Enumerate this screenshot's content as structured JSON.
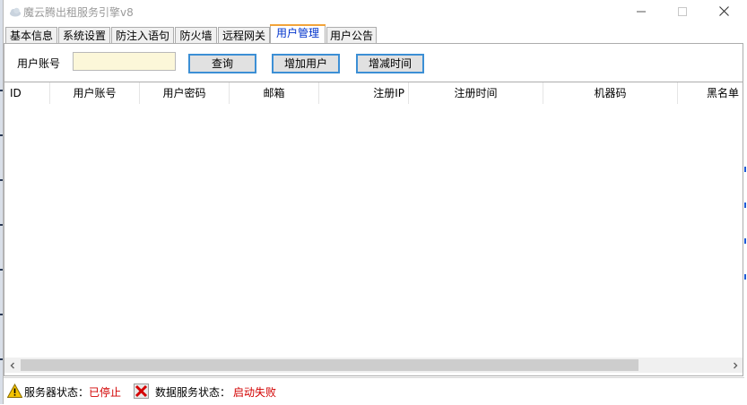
{
  "window": {
    "title": "魔云腾出租服务引擎v8"
  },
  "tabs": [
    {
      "label": "基本信息"
    },
    {
      "label": "系统设置"
    },
    {
      "label": "防注入语句"
    },
    {
      "label": "防火墙"
    },
    {
      "label": "远程网关"
    },
    {
      "label": "用户管理",
      "active": true
    },
    {
      "label": "用户公告"
    }
  ],
  "search": {
    "label": "用户账号",
    "value": "",
    "placeholder": ""
  },
  "buttons": {
    "query": "查询",
    "add_user": "增加用户",
    "adjust_time": "增减时间"
  },
  "table": {
    "columns": [
      "ID",
      "用户账号",
      "用户密码",
      "邮箱",
      "注册IP",
      "注册时间",
      "机器码",
      "黑名单"
    ],
    "rows": []
  },
  "status": {
    "server_label": "服务器状态：",
    "server_value": "已停止",
    "data_label": "数据服务状态：",
    "data_value": "启动失败"
  },
  "colors": {
    "active_tab_text": "#0033cc",
    "active_tab_accent": "#f2a33a",
    "button_border": "#3c8fd5",
    "input_background": "#fcf7d9",
    "status_error": "#d20000"
  },
  "icons": {
    "app": "cloud-icon",
    "server_status": "warning-icon",
    "data_status": "error-x-icon"
  }
}
